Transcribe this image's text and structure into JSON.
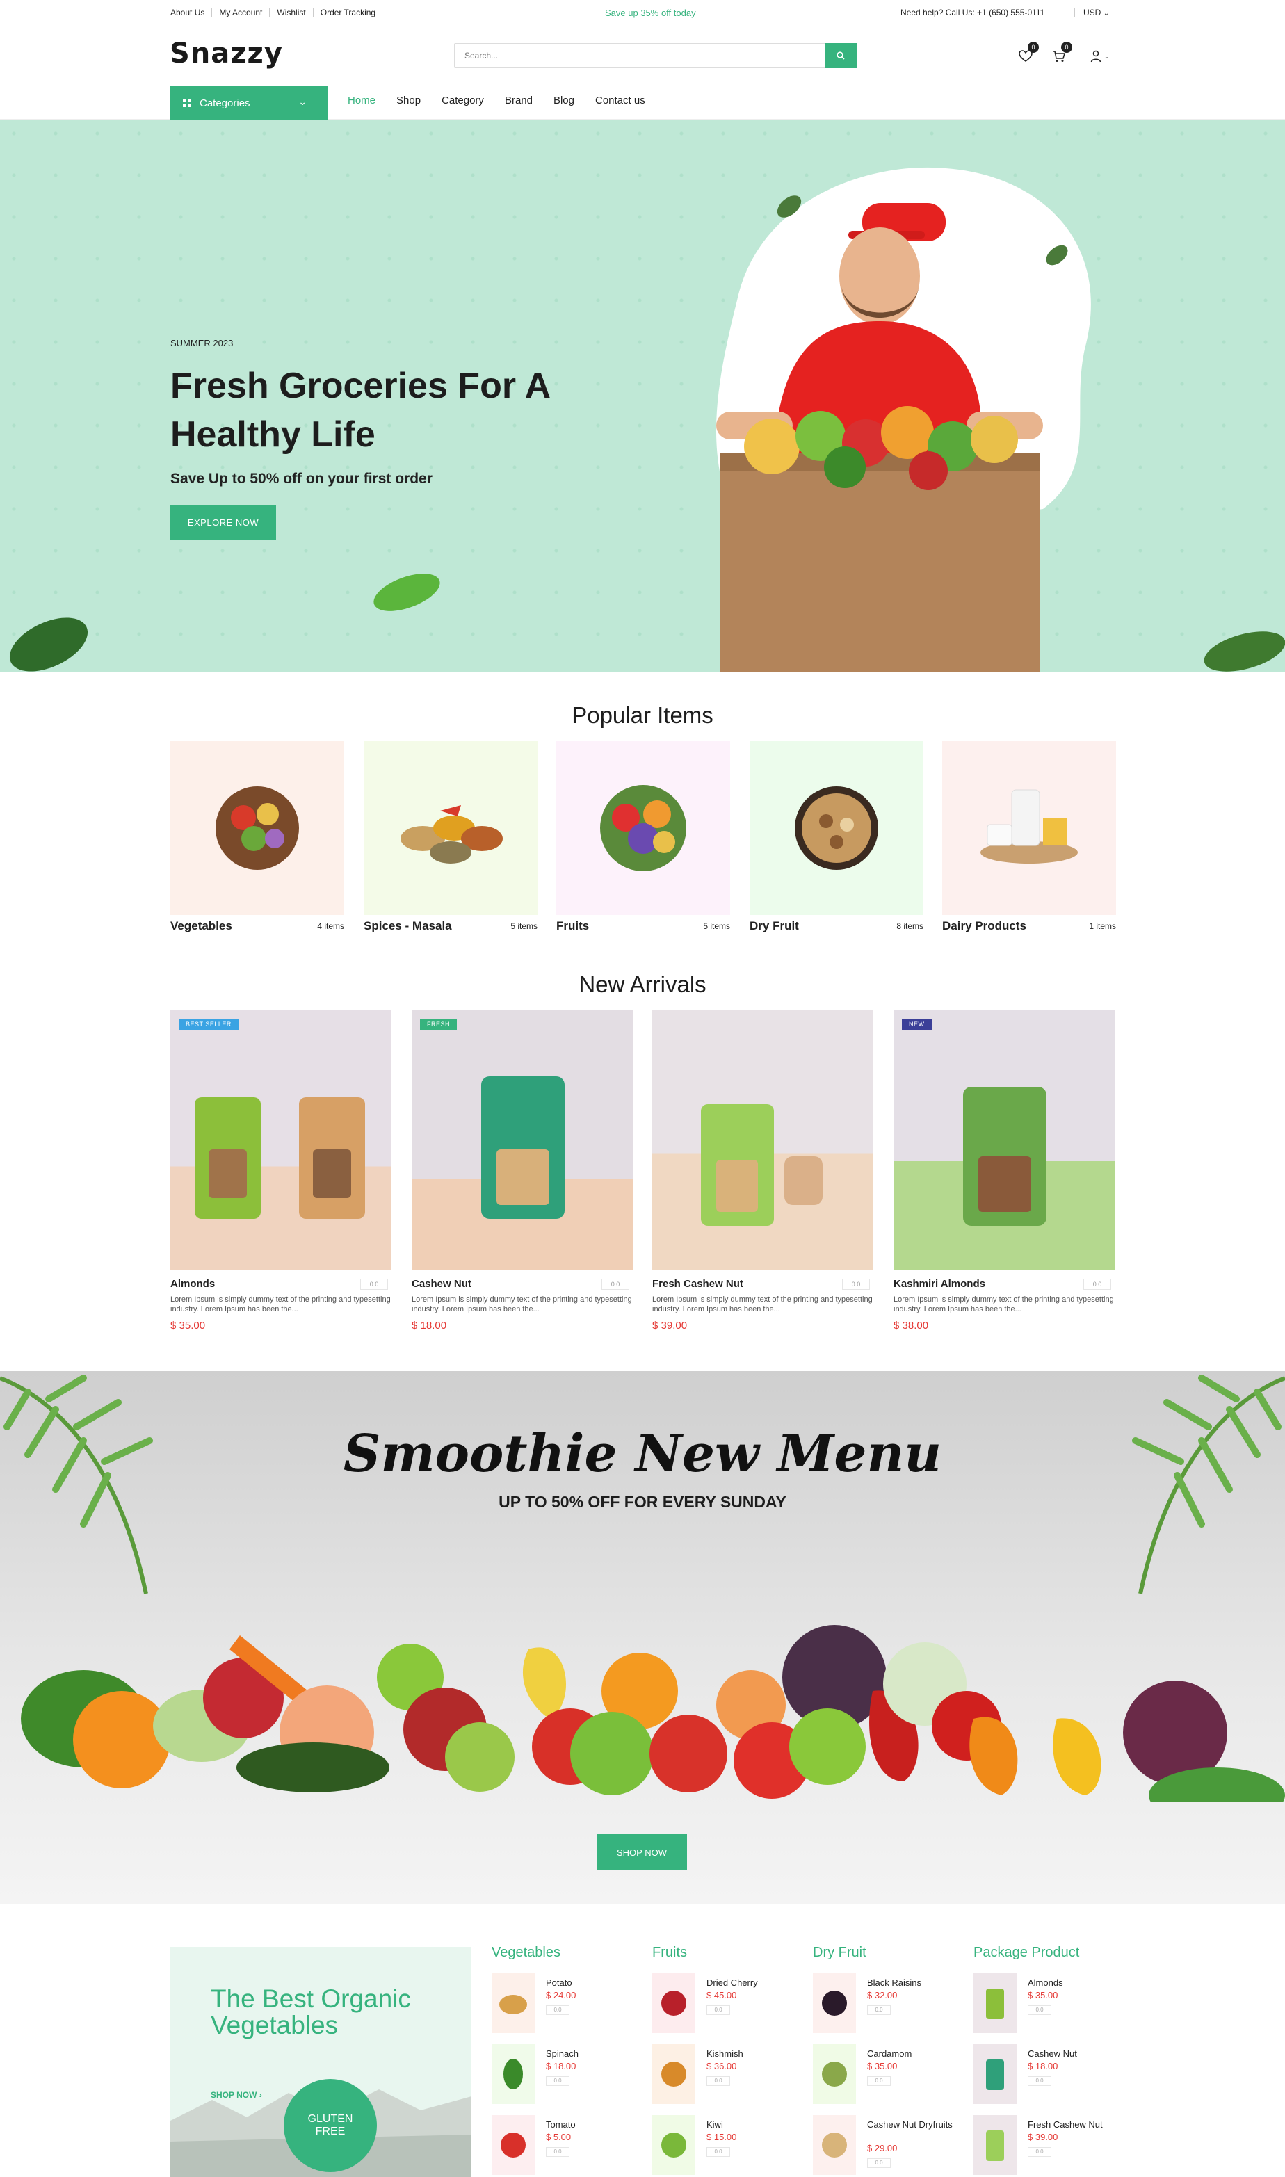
{
  "topbar": {
    "links": [
      "About Us",
      "My Account",
      "Wishlist",
      "Order Tracking"
    ],
    "promo": "Save up 35% off today",
    "help": "Need help? Call Us: +1 (650) 555-0111",
    "currency": "USD"
  },
  "header": {
    "logo": "Snazzy",
    "search_placeholder": "Search...",
    "wishlist_count": "0",
    "cart_count": "0"
  },
  "nav": {
    "categories_label": "Categories",
    "menu": [
      "Home",
      "Shop",
      "Category",
      "Brand",
      "Blog",
      "Contact us"
    ],
    "active": "Home"
  },
  "hero": {
    "eyebrow": "SUMMER 2023",
    "title": "Fresh Groceries For A Healthy Life",
    "subtitle": "Save Up to 50% off on your first order",
    "button": "EXPLORE NOW"
  },
  "popular": {
    "title": "Popular Items",
    "items": [
      {
        "name": "Vegetables",
        "count": "4 items",
        "bg": "#fdf0ea"
      },
      {
        "name": "Spices - Masala",
        "count": "5 items",
        "bg": "#f4fbe8"
      },
      {
        "name": "Fruits",
        "count": "5 items",
        "bg": "#fdf2fb"
      },
      {
        "name": "Dry Fruit",
        "count": "8 items",
        "bg": "#ecfcec"
      },
      {
        "name": "Dairy Products",
        "count": "1 items",
        "bg": "#fdf0ee"
      }
    ]
  },
  "arrivals": {
    "title": "New Arrivals",
    "items": [
      {
        "name": "Almonds",
        "tag": "BEST SELLER",
        "tag_color": "#3aa3e3",
        "rating": "0.0",
        "price": "$ 35.00",
        "desc": "Lorem Ipsum is simply dummy text of the printing and typesetting industry. Lorem Ipsum has been the..."
      },
      {
        "name": "Cashew Nut",
        "tag": "FRESH",
        "tag_color": "#36b37e",
        "rating": "0.0",
        "price": "$ 18.00",
        "desc": "Lorem Ipsum is simply dummy text of the printing and typesetting industry. Lorem Ipsum has been the..."
      },
      {
        "name": "Fresh Cashew Nut",
        "tag": "",
        "tag_color": "",
        "rating": "0.0",
        "price": "$ 39.00",
        "desc": "Lorem Ipsum is simply dummy text of the printing and typesetting industry. Lorem Ipsum has been the..."
      },
      {
        "name": "Kashmiri Almonds",
        "tag": "NEW",
        "tag_color": "#3b3f98",
        "rating": "0.0",
        "price": "$ 38.00",
        "desc": "Lorem Ipsum is simply dummy text of the printing and typesetting industry. Lorem Ipsum has been the..."
      }
    ]
  },
  "banner": {
    "title": "Smoothie New Menu",
    "subtitle": "UP TO 50% OFF FOR EVERY SUNDAY",
    "button": "SHOP NOW"
  },
  "promo_card": {
    "title": "The Best Organic Vegetables",
    "link": "SHOP NOW",
    "stamp": "GLUTEN FREE"
  },
  "columns": [
    {
      "title": "Vegetables",
      "items": [
        {
          "name": "Potato",
          "price": "$ 24.00",
          "rating": "0.0"
        },
        {
          "name": "Spinach",
          "price": "$ 18.00",
          "rating": "0.0"
        },
        {
          "name": "Tomato",
          "price": "$ 5.00",
          "rating": "0.0"
        }
      ]
    },
    {
      "title": "Fruits",
      "items": [
        {
          "name": "Dried Cherry",
          "price": "$ 45.00",
          "rating": "0.0"
        },
        {
          "name": "Kishmish",
          "price": "$ 36.00",
          "rating": "0.0"
        },
        {
          "name": "Kiwi",
          "price": "$ 15.00",
          "rating": "0.0"
        }
      ]
    },
    {
      "title": "Dry Fruit",
      "items": [
        {
          "name": "Black Raisins",
          "price": "$ 32.00",
          "rating": "0.0"
        },
        {
          "name": "Cardamom",
          "price": "$ 35.00",
          "rating": "0.0"
        },
        {
          "name": "Cashew Nut Dryfruits",
          "price": "$ 29.00",
          "rating": "0.0"
        }
      ]
    },
    {
      "title": "Package Product",
      "items": [
        {
          "name": "Almonds",
          "price": "$ 35.00",
          "rating": "0.0"
        },
        {
          "name": "Cashew Nut",
          "price": "$ 18.00",
          "rating": "0.0"
        },
        {
          "name": "Fresh Cashew Nut",
          "price": "$ 39.00",
          "rating": "0.0"
        }
      ]
    }
  ]
}
